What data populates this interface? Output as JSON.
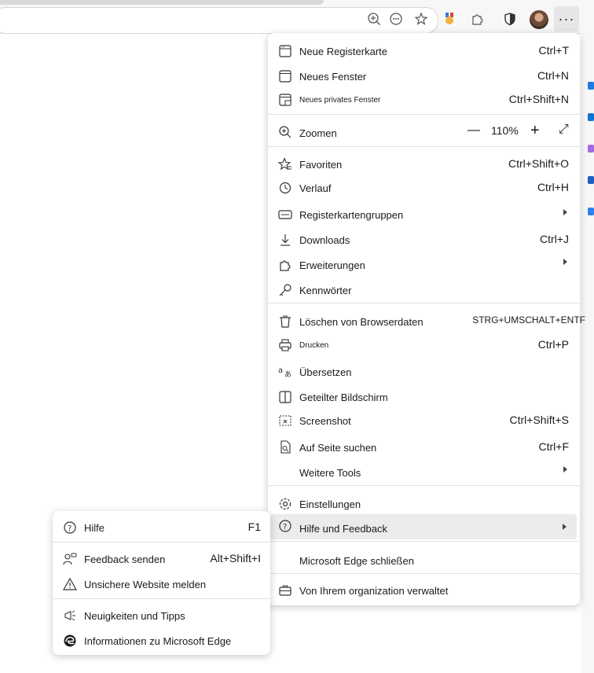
{
  "toolbar": {
    "zoom_icon": "zoom-in-icon",
    "read_aloud_icon": "ellipsis-circle-icon",
    "favorite_icon": "star-icon",
    "rewards_icon": "medal-icon",
    "extensions_icon": "puzzle-icon",
    "security_icon": "shield-icon",
    "more_label": "···"
  },
  "menu": {
    "new_tab": {
      "label": "Neue Registerkarte",
      "shortcut": "Ctrl+T"
    },
    "new_window": {
      "label": "Neues Fenster",
      "shortcut": "Ctrl+N"
    },
    "new_private": {
      "label": "Neues privates Fenster",
      "shortcut": "Ctrl+Shift+N"
    },
    "zoom": {
      "label": "Zoomen",
      "minus": "—",
      "value": "110%",
      "plus": "+",
      "expand": "⤢"
    },
    "favorites": {
      "label": "Favoriten",
      "shortcut": "Ctrl+Shift+O"
    },
    "history": {
      "label": "Verlauf",
      "shortcut": "Ctrl+H"
    },
    "tab_groups": {
      "label": "Registerkartengruppen"
    },
    "downloads": {
      "label": "Downloads",
      "shortcut": "Ctrl+J"
    },
    "extensions": {
      "label": "Erweiterungen"
    },
    "passwords": {
      "label": "Kennwörter"
    },
    "clear_data": {
      "label": "Löschen von Browserdaten",
      "shortcut": "STRG+UMSCHALT+ENTF"
    },
    "print": {
      "label": "Drucken",
      "shortcut": "Ctrl+P"
    },
    "translate": {
      "label": "Übersetzen"
    },
    "split_screen": {
      "label": "Geteilter Bildschirm"
    },
    "screenshot": {
      "label": "Screenshot",
      "shortcut": "Ctrl+Shift+S"
    },
    "find": {
      "label": "Auf Seite suchen",
      "shortcut": "Ctrl+F"
    },
    "more_tools": {
      "label": "Weitere Tools"
    },
    "settings": {
      "label": "Einstellungen"
    },
    "help_feedback": {
      "label": "Hilfe und Feedback"
    },
    "close_edge": {
      "label": "Microsoft Edge schließen"
    },
    "managed": {
      "label": "Von Ihrem organization verwaltet"
    }
  },
  "submenu": {
    "help": {
      "label": "Hilfe",
      "shortcut": "F1"
    },
    "feedback": {
      "label": "Feedback senden",
      "shortcut": "Alt+Shift+I"
    },
    "report_unsafe": {
      "label": "Unsichere Website melden"
    },
    "whats_new": {
      "label": "Neuigkeiten und Tipps"
    },
    "about": {
      "label": "Informationen zu Microsoft Edge"
    }
  },
  "colors": {
    "highlight": "#ebebeb",
    "separator": "#e0e0e0",
    "accent": "#0f6cbd"
  }
}
